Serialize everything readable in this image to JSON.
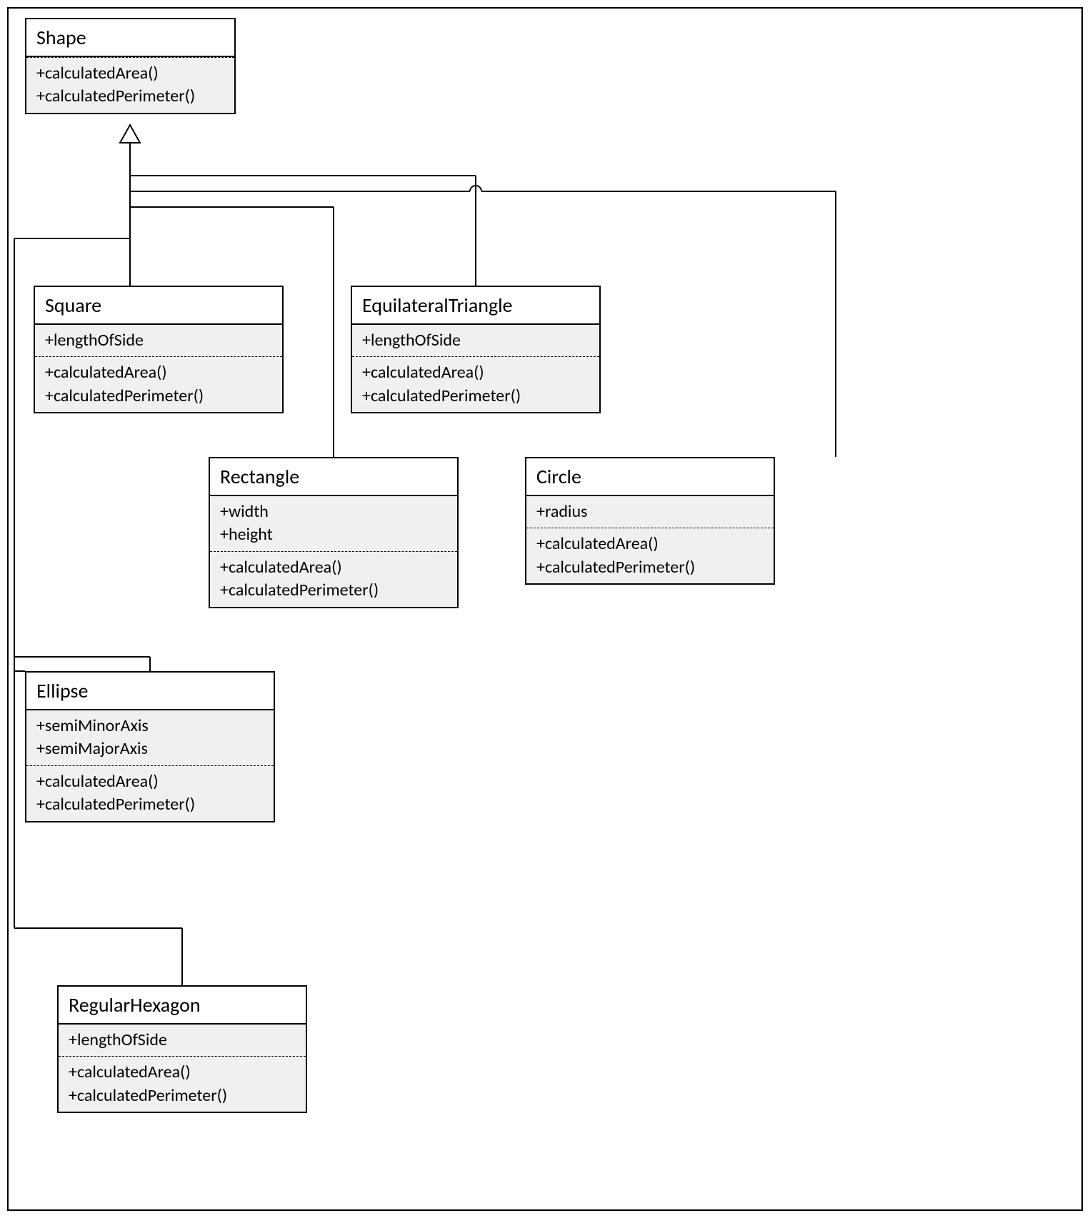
{
  "classes": {
    "shape": {
      "name": "Shape",
      "methods": [
        "+calculatedArea()",
        "+calculatedPerimeter()"
      ]
    },
    "square": {
      "name": "Square",
      "attributes": [
        "+lengthOfSide"
      ],
      "methods": [
        "+calculatedArea()",
        "+calculatedPerimeter()"
      ]
    },
    "equilateralTriangle": {
      "name": "EquilateralTriangle",
      "attributes": [
        "+lengthOfSide"
      ],
      "methods": [
        "+calculatedArea()",
        "+calculatedPerimeter()"
      ]
    },
    "rectangle": {
      "name": "Rectangle",
      "attributes": [
        "+width",
        "+height"
      ],
      "methods": [
        "+calculatedArea()",
        "+calculatedPerimeter()"
      ]
    },
    "circle": {
      "name": "Circle",
      "attributes": [
        "+radius"
      ],
      "methods": [
        "+calculatedArea()",
        "+calculatedPerimeter()"
      ]
    },
    "ellipse": {
      "name": "Ellipse",
      "attributes": [
        "+semiMinorAxis",
        "+semiMajorAxis"
      ],
      "methods": [
        "+calculatedArea()",
        "+calculatedPerimeter()"
      ]
    },
    "regularHexagon": {
      "name": "RegularHexagon",
      "attributes": [
        "+lengthOfSide"
      ],
      "methods": [
        "+calculatedArea()",
        "+calculatedPerimeter()"
      ]
    }
  }
}
